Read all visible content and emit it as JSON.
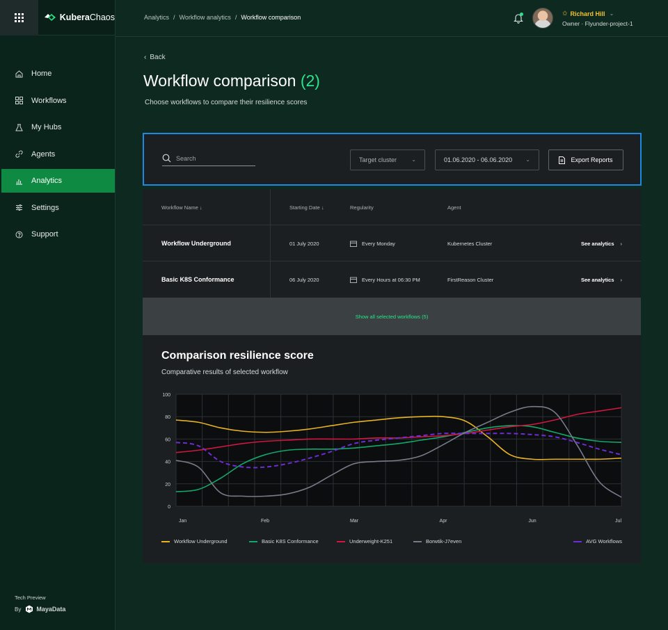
{
  "app": {
    "logo_bold": "Kubera",
    "logo_light": "Chaos"
  },
  "sidebar": {
    "items": [
      {
        "label": "Home",
        "icon": "home-icon",
        "active": false
      },
      {
        "label": "Workflows",
        "icon": "workflows-icon",
        "active": false
      },
      {
        "label": "My Hubs",
        "icon": "flask-icon",
        "active": false
      },
      {
        "label": "Agents",
        "icon": "link-icon",
        "active": false
      },
      {
        "label": "Analytics",
        "icon": "bar-chart-icon",
        "active": true
      },
      {
        "label": "Settings",
        "icon": "sliders-icon",
        "active": false
      },
      {
        "label": "Support",
        "icon": "help-circle-icon",
        "active": false
      }
    ],
    "footer": {
      "preview": "Tech Preview",
      "by": "By",
      "brand": "MayaData"
    }
  },
  "header": {
    "breadcrumb": [
      "Analytics",
      "Workflow analytics",
      "Workflow comparison"
    ],
    "user": {
      "name": "Richard Hill",
      "role": "Owner · Flyunder-project-1"
    }
  },
  "page": {
    "back": "Back",
    "title": "Workflow comparison",
    "count": "(2)",
    "subtitle": "Choose workflows to compare their resilience scores"
  },
  "filters": {
    "search_placeholder": "Search",
    "cluster": "Target cluster",
    "date_range": "01.06.2020 - 06.06.2020",
    "export": "Export Reports"
  },
  "table": {
    "headers": {
      "name": "Workflow Name ↓",
      "date": "Starting Date ↓",
      "regularity": "Regularity",
      "agent": "Agent"
    },
    "rows": [
      {
        "name": "Workflow Underground",
        "date": "01 July 2020",
        "regularity": "Every Monday",
        "agent": "Kubernetes Cluster",
        "link": "See analytics"
      },
      {
        "name": "Basic K8S Conformance",
        "date": "06 July 2020",
        "regularity": "Every Hours at 06:30 PM",
        "agent": "FirstReason Cluster",
        "link": "See analytics"
      }
    ],
    "show_all": "Show all selected workflows (5)"
  },
  "colors": {
    "accent": "#2be38a",
    "active_nav": "#0f8a43",
    "focus_border": "#1e88e5"
  },
  "chart_data": {
    "type": "line",
    "title": "Comparison resilience score",
    "subtitle": "Comparative results of selected workflow",
    "categories": [
      "Jan",
      "Feb",
      "Mar",
      "Apr",
      "Jun",
      "Jul"
    ],
    "x": [
      0,
      0.25,
      0.5,
      0.75,
      1.0,
      1.25,
      1.5,
      1.75,
      2.0,
      2.25,
      2.5,
      2.75,
      3.0,
      3.25,
      3.5,
      3.75,
      4.0,
      4.25,
      4.5,
      4.75,
      5.0
    ],
    "ylim": [
      0,
      100
    ],
    "yticks": [
      0,
      20,
      40,
      60,
      80,
      100
    ],
    "grid": true,
    "legend_position": "bottom",
    "series": [
      {
        "name": "Workflow Underground",
        "color": "#e8b321",
        "dash": false,
        "values": [
          77,
          75,
          70,
          67,
          66,
          67,
          69,
          72,
          75,
          77,
          79,
          80,
          80,
          76,
          62,
          46,
          42,
          42,
          42,
          42,
          43
        ]
      },
      {
        "name": "Basic K8S Conformance",
        "color": "#12a86a",
        "dash": false,
        "values": [
          13,
          15,
          25,
          38,
          46,
          50,
          51,
          51,
          52,
          54,
          56,
          59,
          62,
          66,
          70,
          72,
          71,
          66,
          61,
          58,
          57
        ]
      },
      {
        "name": "Underweight-K251",
        "color": "#d0173f",
        "dash": false,
        "values": [
          48,
          50,
          53,
          56,
          58,
          59,
          60,
          60,
          60,
          61,
          61,
          62,
          63,
          65,
          68,
          71,
          73,
          77,
          82,
          85,
          88
        ]
      },
      {
        "name": "Borwtik-J7even",
        "color": "#787b8a",
        "dash": false,
        "values": [
          41,
          35,
          12,
          9,
          9,
          11,
          17,
          28,
          38,
          40,
          41,
          45,
          55,
          66,
          75,
          84,
          89,
          84,
          55,
          22,
          8
        ]
      },
      {
        "name": "AVG Workflows",
        "color": "#6f2cd6",
        "dash": true,
        "values": [
          57,
          54,
          40,
          35,
          35,
          38,
          43,
          49,
          56,
          59,
          61,
          63,
          65,
          65,
          65,
          65,
          64,
          62,
          57,
          51,
          46
        ]
      }
    ]
  }
}
